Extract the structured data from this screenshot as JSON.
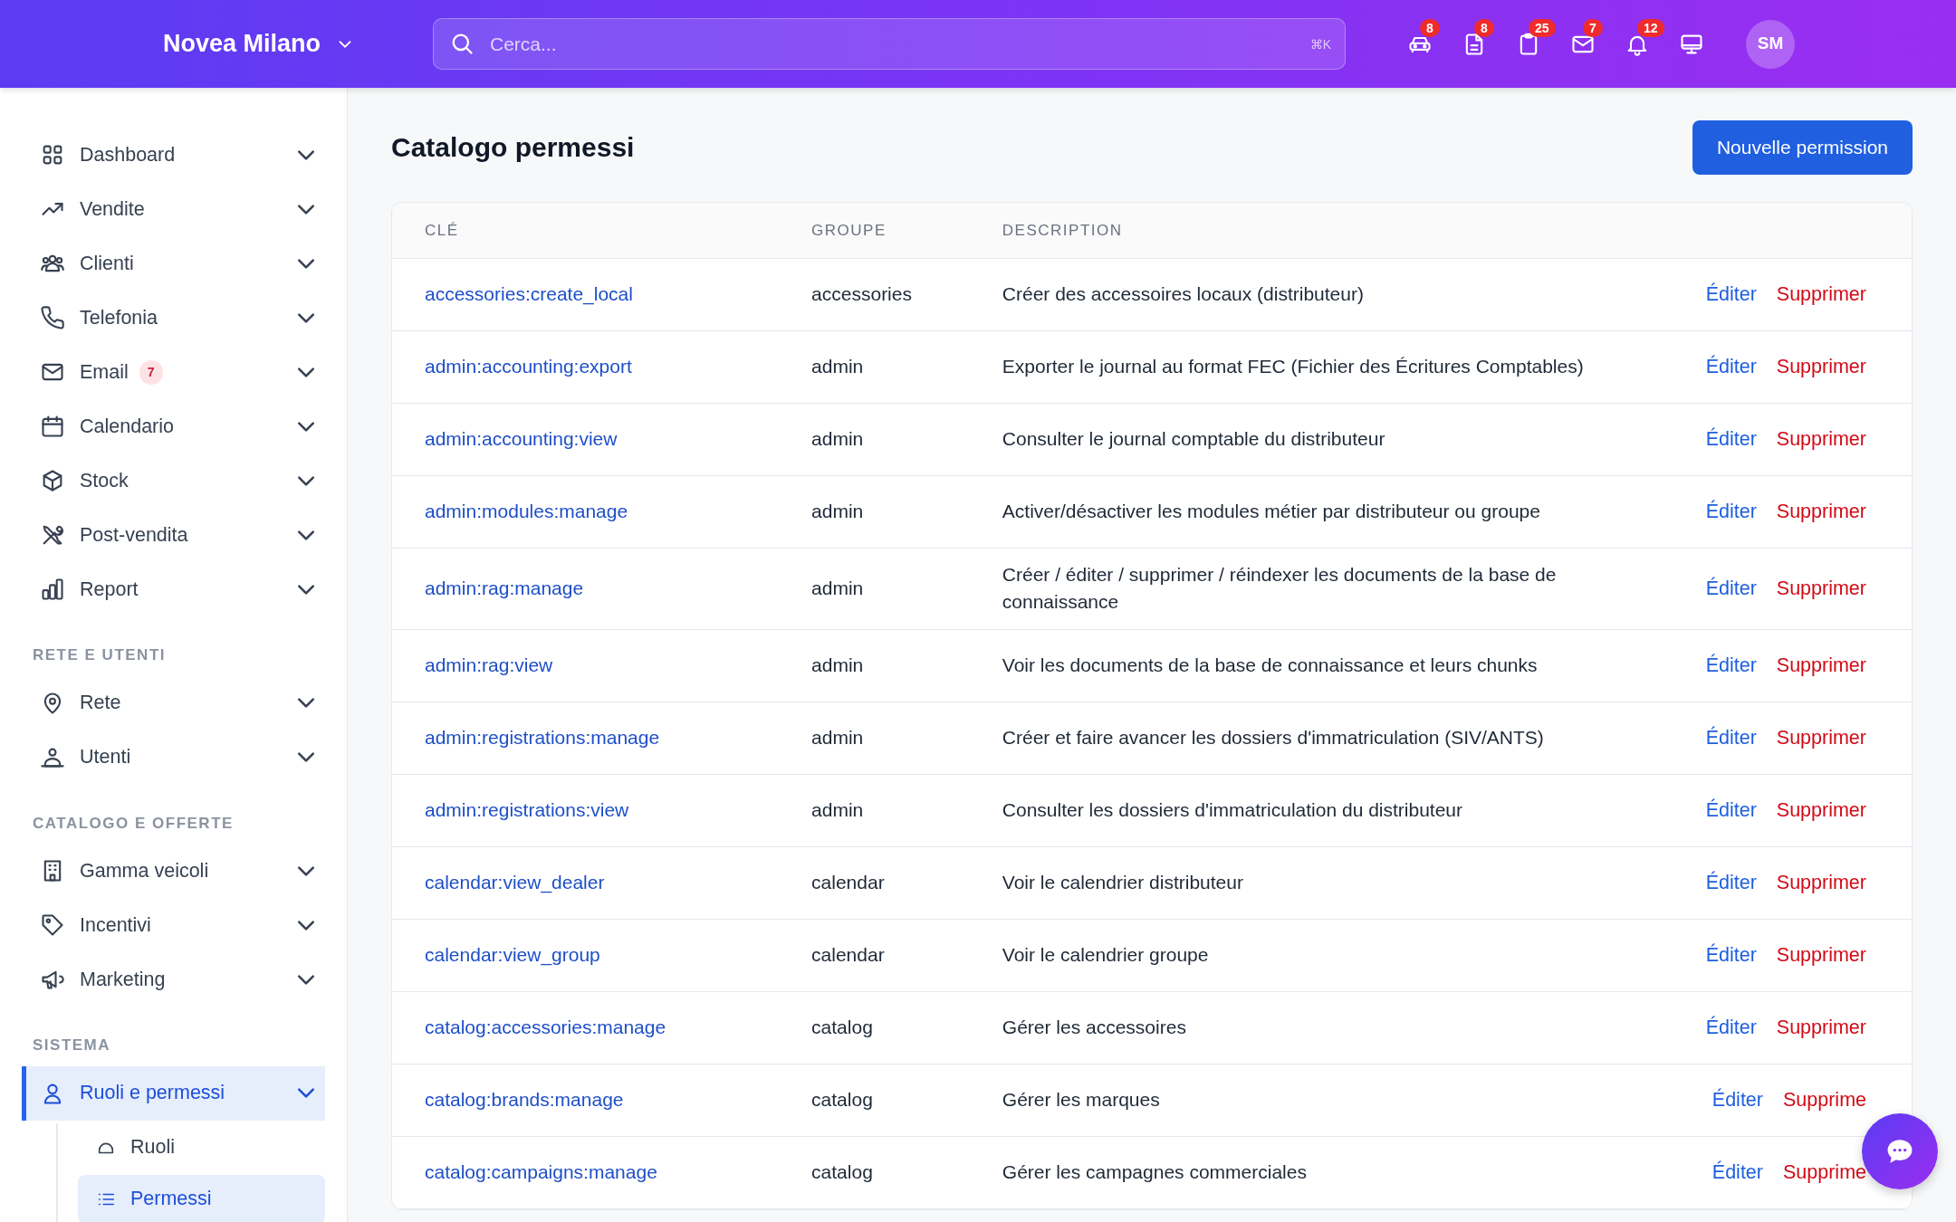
{
  "header": {
    "brand": "Novea Milano",
    "search": {
      "placeholder": "Cerca...",
      "shortcut": "⌘K"
    },
    "icon_badges": [
      "8",
      "8",
      "25",
      "7",
      "12"
    ],
    "avatar": "SM"
  },
  "sidebar": {
    "sections": [
      {
        "items": [
          {
            "label": "Dashboard",
            "selected": false
          },
          {
            "label": "Vendite",
            "selected": false
          },
          {
            "label": "Clienti",
            "selected": false
          },
          {
            "label": "Telefonia",
            "selected": false
          },
          {
            "label": "Email",
            "badge": "7",
            "selected": false
          },
          {
            "label": "Calendario",
            "selected": false
          },
          {
            "label": "Stock",
            "selected": false
          },
          {
            "label": "Post-vendita",
            "selected": false
          },
          {
            "label": "Report",
            "selected": false
          }
        ]
      },
      {
        "title": "RETE E UTENTI",
        "items": [
          {
            "label": "Rete",
            "selected": false
          },
          {
            "label": "Utenti",
            "selected": false
          }
        ]
      },
      {
        "title": "CATALOGO E OFFERTE",
        "items": [
          {
            "label": "Gamma veicoli",
            "selected": false
          },
          {
            "label": "Incentivi",
            "selected": false
          },
          {
            "label": "Marketing",
            "selected": false
          }
        ]
      },
      {
        "title": "SISTEMA",
        "items": [
          {
            "label": "Ruoli e permessi",
            "selected": true,
            "children": [
              {
                "label": "Ruoli",
                "selected": false
              },
              {
                "label": "Permessi",
                "selected": true
              }
            ]
          }
        ]
      }
    ]
  },
  "page": {
    "title": "Catalogo permessi",
    "button": "Nouvelle permission"
  },
  "table": {
    "columns": [
      "CLÉ",
      "GROUPE",
      "DESCRIPTION"
    ],
    "rows": [
      {
        "key": "accessories:create_local",
        "group": "accessories",
        "description": "Créer des accessoires locaux (distributeur)",
        "actions": [
          "Éditer",
          "Supprimer"
        ]
      },
      {
        "key": "admin:accounting:export",
        "group": "admin",
        "description": "Exporter le journal au format FEC (Fichier des Écritures Comptables)",
        "actions": [
          "Éditer",
          "Supprimer"
        ]
      },
      {
        "key": "admin:accounting:view",
        "group": "admin",
        "description": "Consulter le journal comptable du distributeur",
        "actions": [
          "Éditer",
          "Supprimer"
        ]
      },
      {
        "key": "admin:modules:manage",
        "group": "admin",
        "description": "Activer/désactiver les modules métier par distributeur ou groupe",
        "actions": [
          "Éditer",
          "Supprimer"
        ]
      },
      {
        "key": "admin:rag:manage",
        "group": "admin",
        "description": "Créer / éditer / supprimer / réindexer les documents de la base de connaissance",
        "actions": [
          "Éditer",
          "Supprimer"
        ]
      },
      {
        "key": "admin:rag:view",
        "group": "admin",
        "description": "Voir les documents de la base de connaissance et leurs chunks",
        "actions": [
          "Éditer",
          "Supprimer"
        ]
      },
      {
        "key": "admin:registrations:manage",
        "group": "admin",
        "description": "Créer et faire avancer les dossiers d'immatriculation (SIV/ANTS)",
        "actions": [
          "Éditer",
          "Supprimer"
        ]
      },
      {
        "key": "admin:registrations:view",
        "group": "admin",
        "description": "Consulter les dossiers d'immatriculation du distributeur",
        "actions": [
          "Éditer",
          "Supprimer"
        ]
      },
      {
        "key": "calendar:view_dealer",
        "group": "calendar",
        "description": "Voir le calendrier distributeur",
        "actions": [
          "Éditer",
          "Supprimer"
        ]
      },
      {
        "key": "calendar:view_group",
        "group": "calendar",
        "description": "Voir le calendrier groupe",
        "actions": [
          "Éditer",
          "Supprimer"
        ]
      },
      {
        "key": "catalog:accessories:manage",
        "group": "catalog",
        "description": "Gérer les accessoires",
        "actions": [
          "Éditer",
          "Supprimer"
        ]
      },
      {
        "key": "catalog:brands:manage",
        "group": "catalog",
        "description": "Gérer les marques",
        "actions": [
          "Éditer",
          "Supprime"
        ]
      },
      {
        "key": "catalog:campaigns:manage",
        "group": "catalog",
        "description": "Gérer les campagnes commerciales",
        "actions": [
          "Éditer",
          "Supprime"
        ]
      }
    ]
  }
}
